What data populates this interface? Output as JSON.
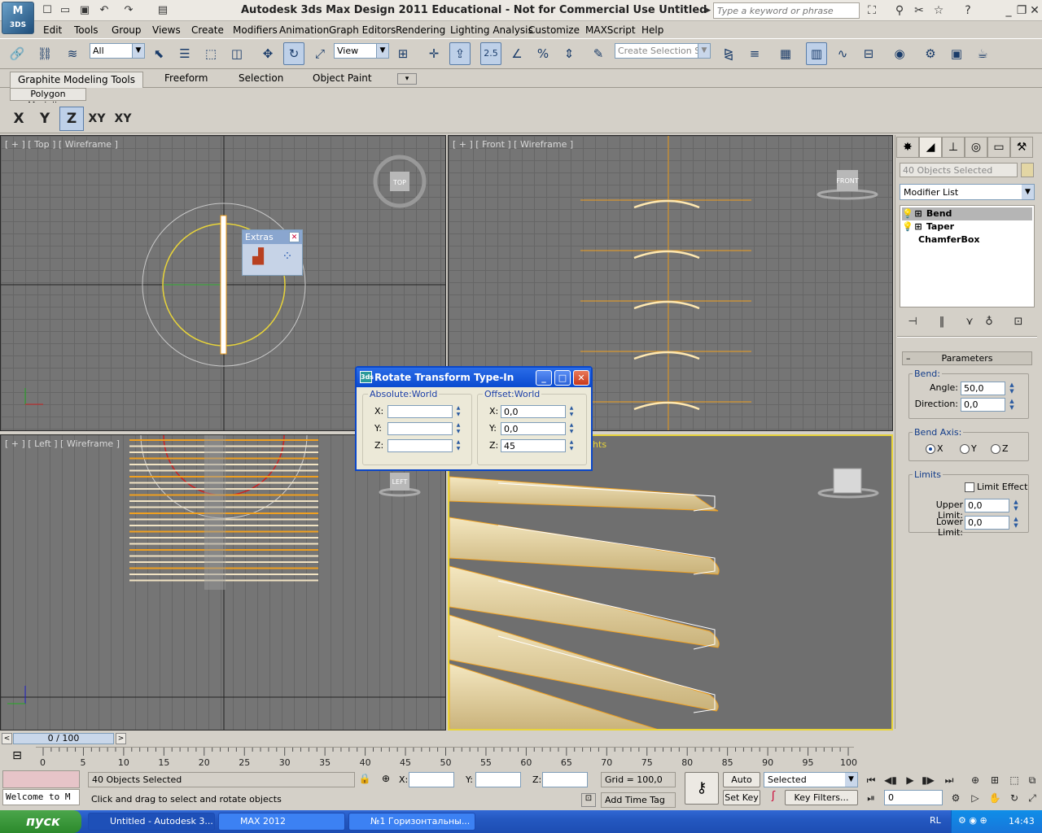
{
  "app": {
    "logo_text": "3DS",
    "title": "Autodesk 3ds Max Design 2011    Educational - Not for Commercial Use    Untitled",
    "search_placeholder": "Type a keyword or phrase"
  },
  "menu": [
    "Edit",
    "Tools",
    "Group",
    "Views",
    "Create",
    "Modifiers",
    "Animation",
    "Graph Editors",
    "Rendering",
    "Lighting Analysis",
    "Customize",
    "MAXScript",
    "Help"
  ],
  "toolbar": {
    "selection_filter": "All",
    "ref_coord": "View",
    "named_selection_placeholder": "Create Selection Se",
    "snap_label": "2.5"
  },
  "ribbon": {
    "tabs": [
      "Graphite Modeling Tools",
      "Freeform",
      "Selection",
      "Object Paint"
    ],
    "panel": "Polygon Modeling",
    "axes": [
      "X",
      "Y",
      "Z",
      "XY",
      "XY"
    ]
  },
  "viewports": {
    "top": "[ + ] [ Top ] [ Wireframe ]",
    "front": "[ + ] [ Front ] [ Wireframe ]",
    "left": "[ + ] [ Left ] [ Wireframe ]",
    "persp_suffix": "ights",
    "viewcube_top": "TOP",
    "viewcube_front": "FRONT",
    "viewcube_left": "LEFT"
  },
  "extras": {
    "title": "Extras"
  },
  "rotate_dialog": {
    "title": "Rotate Transform Type-In",
    "absolute_label": "Absolute:World",
    "offset_label": "Offset:World",
    "absolute": {
      "x": "",
      "y": "",
      "z": ""
    },
    "offset": {
      "x": "0,0",
      "y": "0,0",
      "z": "45"
    }
  },
  "command_panel": {
    "selection_name": "40 Objects Selected",
    "modifier_list": "Modifier List",
    "stack": [
      "Bend",
      "Taper",
      "ChamferBox"
    ],
    "rollout_title": "Parameters",
    "bend_group": "Bend:",
    "angle_label": "Angle:",
    "angle": "50,0",
    "direction_label": "Direction:",
    "direction": "0,0",
    "bend_axis_group": "Bend Axis:",
    "axes": [
      "X",
      "Y",
      "Z"
    ],
    "selected_axis": "X",
    "limits_group": "Limits",
    "limit_effect": "Limit Effect",
    "upper_limit_label": "Upper Limit:",
    "upper_limit": "0,0",
    "lower_limit_label": "Lower Limit:",
    "lower_limit": "0,0"
  },
  "timeline": {
    "frame": "0 / 100",
    "ticks": [
      "0",
      "5",
      "10",
      "15",
      "20",
      "25",
      "30",
      "35",
      "40",
      "45",
      "50",
      "55",
      "60",
      "65",
      "70",
      "75",
      "80",
      "85",
      "90",
      "95",
      "100"
    ]
  },
  "status": {
    "listener": "Welcome to M",
    "selected": "40 Objects Selected",
    "prompt": "Click and drag to select and rotate objects",
    "x_label": "X:",
    "y_label": "Y:",
    "z_label": "Z:",
    "grid": "Grid = 100,0",
    "add_time_tag": "Add Time Tag",
    "auto_key": "Auto Key",
    "set_key": "Set Key",
    "key_mode": "Selected",
    "key_filters": "Key Filters...",
    "current_frame": "0"
  },
  "taskbar": {
    "start": "пуск",
    "items": [
      "Untitled - Autodesk 3...",
      "MAX 2012",
      "№1 Горизонтальны..."
    ],
    "lang": "RL",
    "clock": "14:43"
  },
  "colors": {
    "selection_orange": "#f0a020",
    "persp_border": "#e8d43a",
    "plank": "#e8d49a"
  }
}
